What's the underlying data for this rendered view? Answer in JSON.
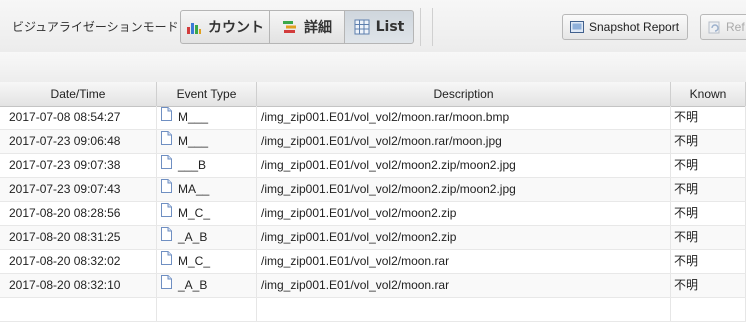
{
  "toolbar": {
    "mode_label": "ビジュアライゼーションモード：",
    "modes": [
      {
        "label": "カウント",
        "icon": "bar-chart-icon"
      },
      {
        "label": "詳細",
        "icon": "details-icon"
      },
      {
        "label": "List",
        "icon": "table-icon"
      }
    ],
    "selected_mode": "List",
    "snapshot_label": "Snapshot Report",
    "refresh_label": "Ref"
  },
  "table": {
    "columns": [
      "Date/Time",
      "Event Type",
      "Description",
      "Known"
    ],
    "rows": [
      {
        "datetime": "2017-07-08 08:54:27",
        "event": "M___",
        "description": "/img_zip001.E01/vol_vol2/moon.rar/moon.bmp",
        "known": "不明"
      },
      {
        "datetime": "2017-07-23 09:06:48",
        "event": "M___",
        "description": "/img_zip001.E01/vol_vol2/moon.rar/moon.jpg",
        "known": "不明"
      },
      {
        "datetime": "2017-07-23 09:07:38",
        "event": "___B",
        "description": "/img_zip001.E01/vol_vol2/moon2.zip/moon2.jpg",
        "known": "不明"
      },
      {
        "datetime": "2017-07-23 09:07:43",
        "event": "MA__",
        "description": "/img_zip001.E01/vol_vol2/moon2.zip/moon2.jpg",
        "known": "不明"
      },
      {
        "datetime": "2017-08-20 08:28:56",
        "event": "M_C_",
        "description": "/img_zip001.E01/vol_vol2/moon2.zip",
        "known": "不明"
      },
      {
        "datetime": "2017-08-20 08:31:25",
        "event": "_A_B",
        "description": "/img_zip001.E01/vol_vol2/moon2.zip",
        "known": "不明"
      },
      {
        "datetime": "2017-08-20 08:32:02",
        "event": "M_C_",
        "description": "/img_zip001.E01/vol_vol2/moon.rar",
        "known": "不明"
      },
      {
        "datetime": "2017-08-20 08:32:10",
        "event": "_A_B",
        "description": "/img_zip001.E01/vol_vol2/moon.rar",
        "known": "不明"
      }
    ]
  }
}
